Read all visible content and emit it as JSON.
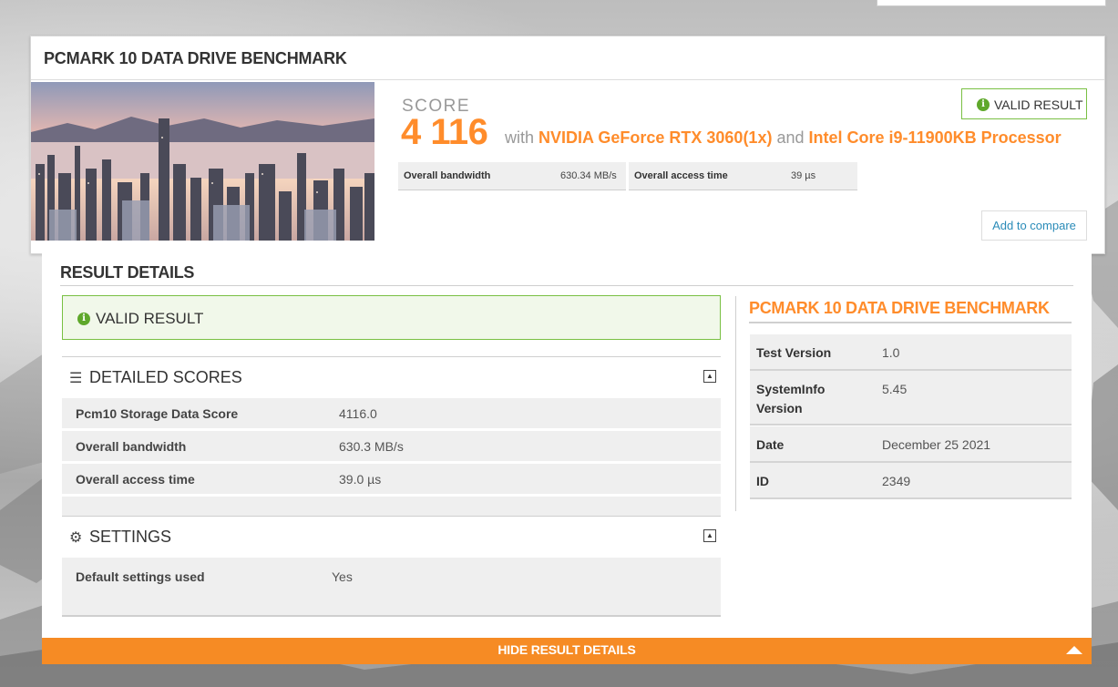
{
  "card": {
    "title": "PCMARK 10 DATA DRIVE BENCHMARK",
    "score_label": "SCORE",
    "score_value": "4 116",
    "with_text": "with",
    "gpu": "NVIDIA GeForce RTX 3060(1x)",
    "and_text": "and",
    "cpu": "Intel Core i9-11900KB Processor",
    "metrics": [
      {
        "label": "Overall bandwidth",
        "value": "630.34 MB/s"
      },
      {
        "label": "Overall access time",
        "value": "39 µs"
      }
    ],
    "valid_badge": "VALID RESULT",
    "compare_button": "Add to compare"
  },
  "details": {
    "title": "RESULT DETAILS",
    "valid_text": "VALID RESULT",
    "detailed_scores": {
      "title": "DETAILED SCORES",
      "rows": [
        {
          "label": "Pcm10 Storage Data Score",
          "value": "4116.0"
        },
        {
          "label": "Overall bandwidth",
          "value": "630.3 MB/s"
        },
        {
          "label": "Overall access time",
          "value": "39.0 µs"
        }
      ]
    },
    "settings": {
      "title": "SETTINGS",
      "rows": [
        {
          "label": "Default settings used",
          "value": "Yes"
        }
      ]
    },
    "side": {
      "title": "PCMARK 10 DATA DRIVE BENCHMARK",
      "rows": [
        {
          "label": "Test Version",
          "value": "1.0"
        },
        {
          "label": "SystemInfo Version",
          "value": "5.45"
        },
        {
          "label": "Date",
          "value": "December 25 2021"
        },
        {
          "label": "ID",
          "value": "2349"
        }
      ]
    }
  },
  "footer": {
    "hide_label": "HIDE RESULT DETAILS"
  },
  "icons": {
    "info": "info-icon",
    "list": "list-icon",
    "gear": "gear-icon",
    "collapse": "collapse-up-icon",
    "triangle": "triangle-up-icon"
  },
  "colors": {
    "accent": "#f68b24",
    "valid_green": "#79c043",
    "link_blue": "#2a8bb8"
  }
}
